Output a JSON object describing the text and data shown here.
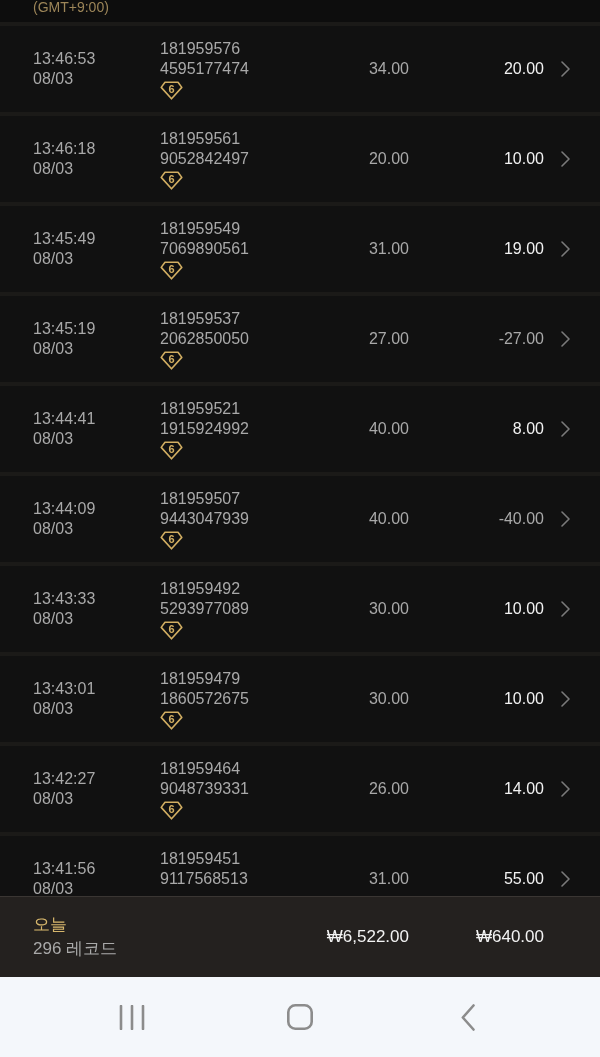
{
  "header": {
    "timezone": "(GMT+9:00)"
  },
  "records": [
    {
      "time": "13:46:53",
      "date": "08/03",
      "id_line_1": "181959576",
      "id_line_2": "4595177474",
      "badge": "6",
      "amount_1": "34.00",
      "amount_2": "20.00",
      "loss": false
    },
    {
      "time": "13:46:18",
      "date": "08/03",
      "id_line_1": "181959561",
      "id_line_2": "9052842497",
      "badge": "6",
      "amount_1": "20.00",
      "amount_2": "10.00",
      "loss": false
    },
    {
      "time": "13:45:49",
      "date": "08/03",
      "id_line_1": "181959549",
      "id_line_2": "7069890561",
      "badge": "6",
      "amount_1": "31.00",
      "amount_2": "19.00",
      "loss": false
    },
    {
      "time": "13:45:19",
      "date": "08/03",
      "id_line_1": "181959537",
      "id_line_2": "2062850050",
      "badge": "6",
      "amount_1": "27.00",
      "amount_2": "-27.00",
      "loss": true
    },
    {
      "time": "13:44:41",
      "date": "08/03",
      "id_line_1": "181959521",
      "id_line_2": "1915924992",
      "badge": "6",
      "amount_1": "40.00",
      "amount_2": "8.00",
      "loss": false
    },
    {
      "time": "13:44:09",
      "date": "08/03",
      "id_line_1": "181959507",
      "id_line_2": "9443047939",
      "badge": "6",
      "amount_1": "40.00",
      "amount_2": "-40.00",
      "loss": true
    },
    {
      "time": "13:43:33",
      "date": "08/03",
      "id_line_1": "181959492",
      "id_line_2": "5293977089",
      "badge": "6",
      "amount_1": "30.00",
      "amount_2": "10.00",
      "loss": false
    },
    {
      "time": "13:43:01",
      "date": "08/03",
      "id_line_1": "181959479",
      "id_line_2": "1860572675",
      "badge": "6",
      "amount_1": "30.00",
      "amount_2": "10.00",
      "loss": false
    },
    {
      "time": "13:42:27",
      "date": "08/03",
      "id_line_1": "181959464",
      "id_line_2": "9048739331",
      "badge": "6",
      "amount_1": "26.00",
      "amount_2": "14.00",
      "loss": false
    },
    {
      "time": "13:41:56",
      "date": "08/03",
      "id_line_1": "181959451",
      "id_line_2": "9117568513",
      "amount_1": "31.00",
      "amount_2": "55.00",
      "loss": false
    }
  ],
  "summary": {
    "label": "오늘",
    "count": "296 레코드",
    "total_1": "₩6,522.00",
    "total_2": "₩640.00"
  }
}
